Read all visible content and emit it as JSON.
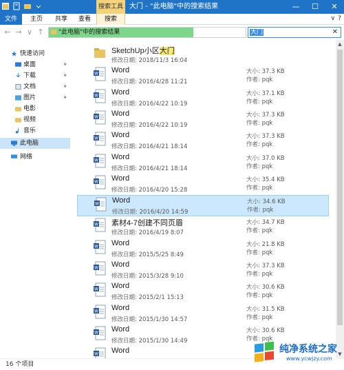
{
  "window": {
    "title": "大门 - \"此电脑\"中的搜索结果",
    "contextual_tab": "搜索工具",
    "controls": [
      "—",
      "☐",
      "✕"
    ]
  },
  "ribbon": {
    "tabs": [
      "文件",
      "主页",
      "共享",
      "查看",
      "搜索"
    ],
    "right_icons": [
      "∨",
      "?"
    ]
  },
  "address": {
    "path": "\"此电脑\"中的搜索结果",
    "back": "←",
    "forward": "→",
    "recent": "∨",
    "up": "↑",
    "dropdown": "∨",
    "close": "✕"
  },
  "search": {
    "value": "大门",
    "clear": "✕"
  },
  "nav": {
    "quick_access": "快速访问",
    "items": [
      {
        "label": "桌面",
        "icon": "desktop-icon",
        "pinned": true
      },
      {
        "label": "下载",
        "icon": "download-icon",
        "pinned": true
      },
      {
        "label": "文档",
        "icon": "documents-icon",
        "pinned": true
      },
      {
        "label": "图片",
        "icon": "pictures-icon",
        "pinned": true
      },
      {
        "label": "电影",
        "icon": "movies-icon",
        "pinned": false
      },
      {
        "label": "视频",
        "icon": "videos-icon",
        "pinned": false
      },
      {
        "label": "音乐",
        "icon": "music-icon",
        "pinned": false
      }
    ],
    "this_pc": "此电脑",
    "network": "网络",
    "pin_glyph": "✦"
  },
  "labels": {
    "modified": "修改日期:",
    "size": "大小:",
    "author": "作者:"
  },
  "results": [
    {
      "name_pre": "SketchUp小区",
      "name_hl": "大门",
      "date": "2018/11/3 16:04",
      "type": "folder",
      "size": "",
      "author": ""
    },
    {
      "name_pre": "Word",
      "name_hl": "",
      "date": "2016/4/28 11:21",
      "type": "word",
      "size": "37.3 KB",
      "author": "pqk"
    },
    {
      "name_pre": "Word",
      "name_hl": "",
      "date": "2016/4/22 10:19",
      "type": "word",
      "size": "37.1 KB",
      "author": "pqk"
    },
    {
      "name_pre": "Word",
      "name_hl": "",
      "date": "2016/4/22 10:19",
      "type": "word",
      "size": "37.3 KB",
      "author": "pqk"
    },
    {
      "name_pre": "Word",
      "name_hl": "",
      "date": "2016/4/21 18:14",
      "type": "word",
      "size": "37.3 KB",
      "author": "pqk"
    },
    {
      "name_pre": "Word",
      "name_hl": "",
      "date": "2016/4/21 18:14",
      "type": "word",
      "size": "37.0 KB",
      "author": "pqk"
    },
    {
      "name_pre": "Word",
      "name_hl": "",
      "date": "2016/4/20 15:28",
      "type": "word",
      "size": "35.4 KB",
      "author": "pqk"
    },
    {
      "name_pre": "Word",
      "name_hl": "",
      "date": "2016/4/20 14:59",
      "type": "word",
      "size": "34.6 KB",
      "author": "pqk",
      "selected": true
    },
    {
      "name_pre": "素材4-7创建不同页眉",
      "name_hl": "",
      "date": "2016/4/19 8:07",
      "type": "word",
      "size": "34.7 KB",
      "author": "pqk"
    },
    {
      "name_pre": "Word",
      "name_hl": "",
      "date": "2015/5/25 8:49",
      "type": "word",
      "size": "21.8 KB",
      "author": "pqk"
    },
    {
      "name_pre": "Word",
      "name_hl": "",
      "date": "2015/3/28 9:10",
      "type": "word",
      "size": "37.3 KB",
      "author": "pqk"
    },
    {
      "name_pre": "Word",
      "name_hl": "",
      "date": "2015/2/1 15:13",
      "type": "word",
      "size": "30.6 KB",
      "author": "pqk"
    },
    {
      "name_pre": "Word",
      "name_hl": "",
      "date": "2015/1/30 14:57",
      "type": "word",
      "size": "31.5 KB",
      "author": "pqk"
    },
    {
      "name_pre": "Word",
      "name_hl": "",
      "date": "2015/1/30 14:49",
      "type": "word",
      "size": "30.6 KB",
      "author": "pqk"
    },
    {
      "name_pre": "Word",
      "name_hl": "",
      "date": "",
      "type": "word",
      "size": "",
      "author": ""
    }
  ],
  "status": {
    "count": "16 个项目"
  },
  "watermark": {
    "title": "纯净系统之家",
    "url": "www.ycwjzy.com"
  },
  "colors": {
    "accent": "#1f74c8",
    "selection": "#cce8ff",
    "highlight": "#f5e87a",
    "address_fill": "#7dd68a"
  }
}
